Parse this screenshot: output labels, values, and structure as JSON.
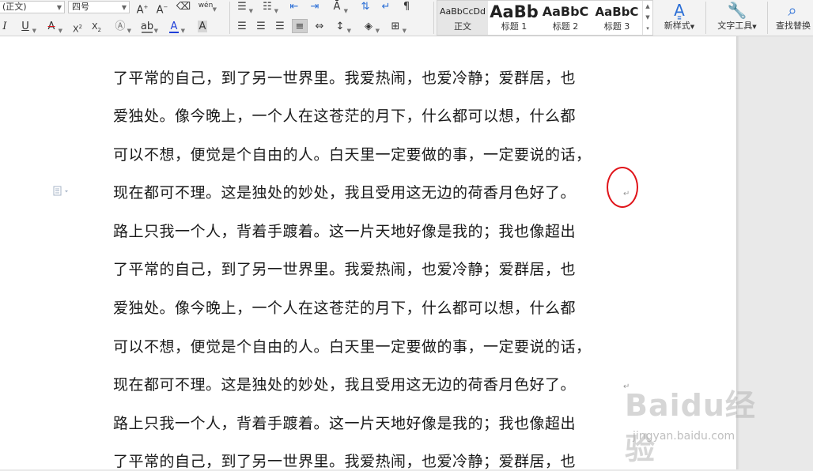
{
  "ribbon": {
    "font_name": "(正文)",
    "font_size": "四号",
    "pinyin_label": "wén",
    "styles": [
      {
        "preview": "AaBbCcDd",
        "name": "正文"
      },
      {
        "preview": "AaBb",
        "name": "标题 1"
      },
      {
        "preview": "AaBbC",
        "name": "标题 2"
      },
      {
        "preview": "AaBbC",
        "name": "标题 3"
      }
    ],
    "new_style_label": "新样式",
    "text_tools_label": "文字工具",
    "find_replace_label": "查找替换",
    "font_color": "#1f3fd8",
    "highlight_color": "#e0141a"
  },
  "document": {
    "lines": [
      "了平常的自己，到了另一世界里。我爱热闹，也爱冷静；爱群居，也",
      "爱独处。像今晚上，一个人在这苍茫的月下，什么都可以想，什么都",
      "可以不想，便觉是个自由的人。白天里一定要做的事，一定要说的话，",
      "现在都可不理。这是独处的妙处，我且受用这无边的荷香月色好了。",
      "路上只我一个人，背着手踱着。这一片天地好像是我的；我也像超出",
      "了平常的自己，到了另一世界里。我爱热闹，也爱冷静；爱群居，也",
      "爱独处。像今晚上，一个人在这苍茫的月下，什么都可以想，什么都",
      "可以不想，便觉是个自由的人。白天里一定要做的事，一定要说的话，",
      "现在都可不理。这是独处的妙处，我且受用这无边的荷香月色好了。",
      "路上只我一个人，背着手踱着。这一片天地好像是我的；我也像超出",
      "了平常的自己，到了另一世界里。我爱热闹，也爱冷静；爱群居，也"
    ],
    "paragraph_mark": "↵",
    "annotation_color": "#e0141a"
  },
  "watermark": {
    "logo": "Baidu经验",
    "url": "jingyan.baidu.com"
  }
}
